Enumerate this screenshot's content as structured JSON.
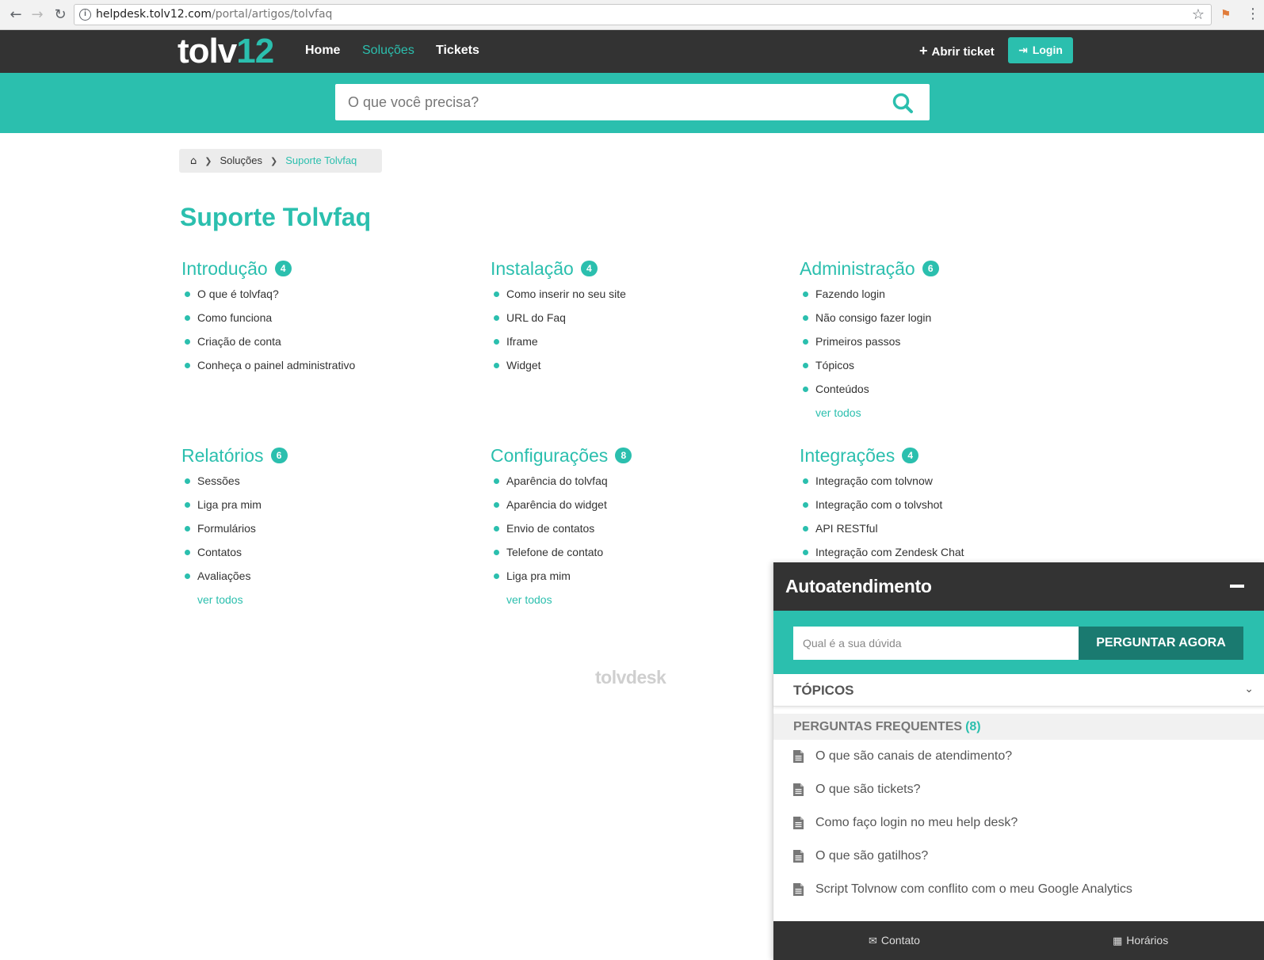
{
  "browser": {
    "url_host": "helpdesk.tolv12.com",
    "url_path": "/portal/artigos/tolvfaq"
  },
  "header": {
    "logo_part1": "tolv",
    "logo_part2": "12",
    "nav": [
      "Home",
      "Soluções",
      "Tickets"
    ],
    "active_nav": "Soluções",
    "open_ticket": "Abrir ticket",
    "login": "Login"
  },
  "search": {
    "placeholder": "O que você precisa?"
  },
  "breadcrumb": {
    "items": [
      "Soluções",
      "Suporte Tolvfaq"
    ]
  },
  "page": {
    "title": "Suporte Tolvfaq"
  },
  "categories": [
    {
      "name": "Introdução",
      "count": "4",
      "articles": [
        "O que é tolvfaq?",
        "Como funciona",
        "Criação de conta",
        "Conheça o painel administrativo"
      ],
      "see_all": ""
    },
    {
      "name": "Instalação",
      "count": "4",
      "articles": [
        "Como inserir no seu site",
        "URL do Faq",
        "Iframe",
        "Widget"
      ],
      "see_all": ""
    },
    {
      "name": "Administração",
      "count": "6",
      "articles": [
        "Fazendo login",
        "Não consigo fazer login",
        "Primeiros passos",
        "Tópicos",
        "Conteúdos"
      ],
      "see_all": "ver todos"
    },
    {
      "name": "Relatórios",
      "count": "6",
      "articles": [
        "Sessões",
        "Liga pra mim",
        "Formulários",
        "Contatos",
        "Avaliações"
      ],
      "see_all": "ver todos"
    },
    {
      "name": "Configurações",
      "count": "8",
      "articles": [
        "Aparência do tolvfaq",
        "Aparência do widget",
        "Envio de contatos",
        "Telefone de contato",
        "Liga pra mim"
      ],
      "see_all": "ver todos"
    },
    {
      "name": "Integrações",
      "count": "4",
      "articles": [
        "Integração com tolvnow",
        "Integração com o tolvshot",
        "API RESTful",
        "Integração com Zendesk Chat"
      ],
      "see_all": ""
    }
  ],
  "footer": {
    "brand": "tolvdesk"
  },
  "widget": {
    "title": "Autoatendimento",
    "ask_placeholder": "Qual é a sua dúvida",
    "ask_button": "PERGUNTAR AGORA",
    "topics_label": "TÓPICOS",
    "faq_label": "PERGUNTAS FREQUENTES",
    "faq_count": "(8)",
    "faq_items": [
      "O que são canais de atendimento?",
      "O que são tickets?",
      "Como faço login no meu help desk?",
      "O que são gatilhos?",
      "Script Tolvnow com conflito com o meu Google Analytics"
    ],
    "footer_contact": "Contato",
    "footer_hours": "Horários"
  },
  "colors": {
    "accent": "#2bbfae",
    "dark": "#333333",
    "ask_button": "#1a7a70"
  }
}
